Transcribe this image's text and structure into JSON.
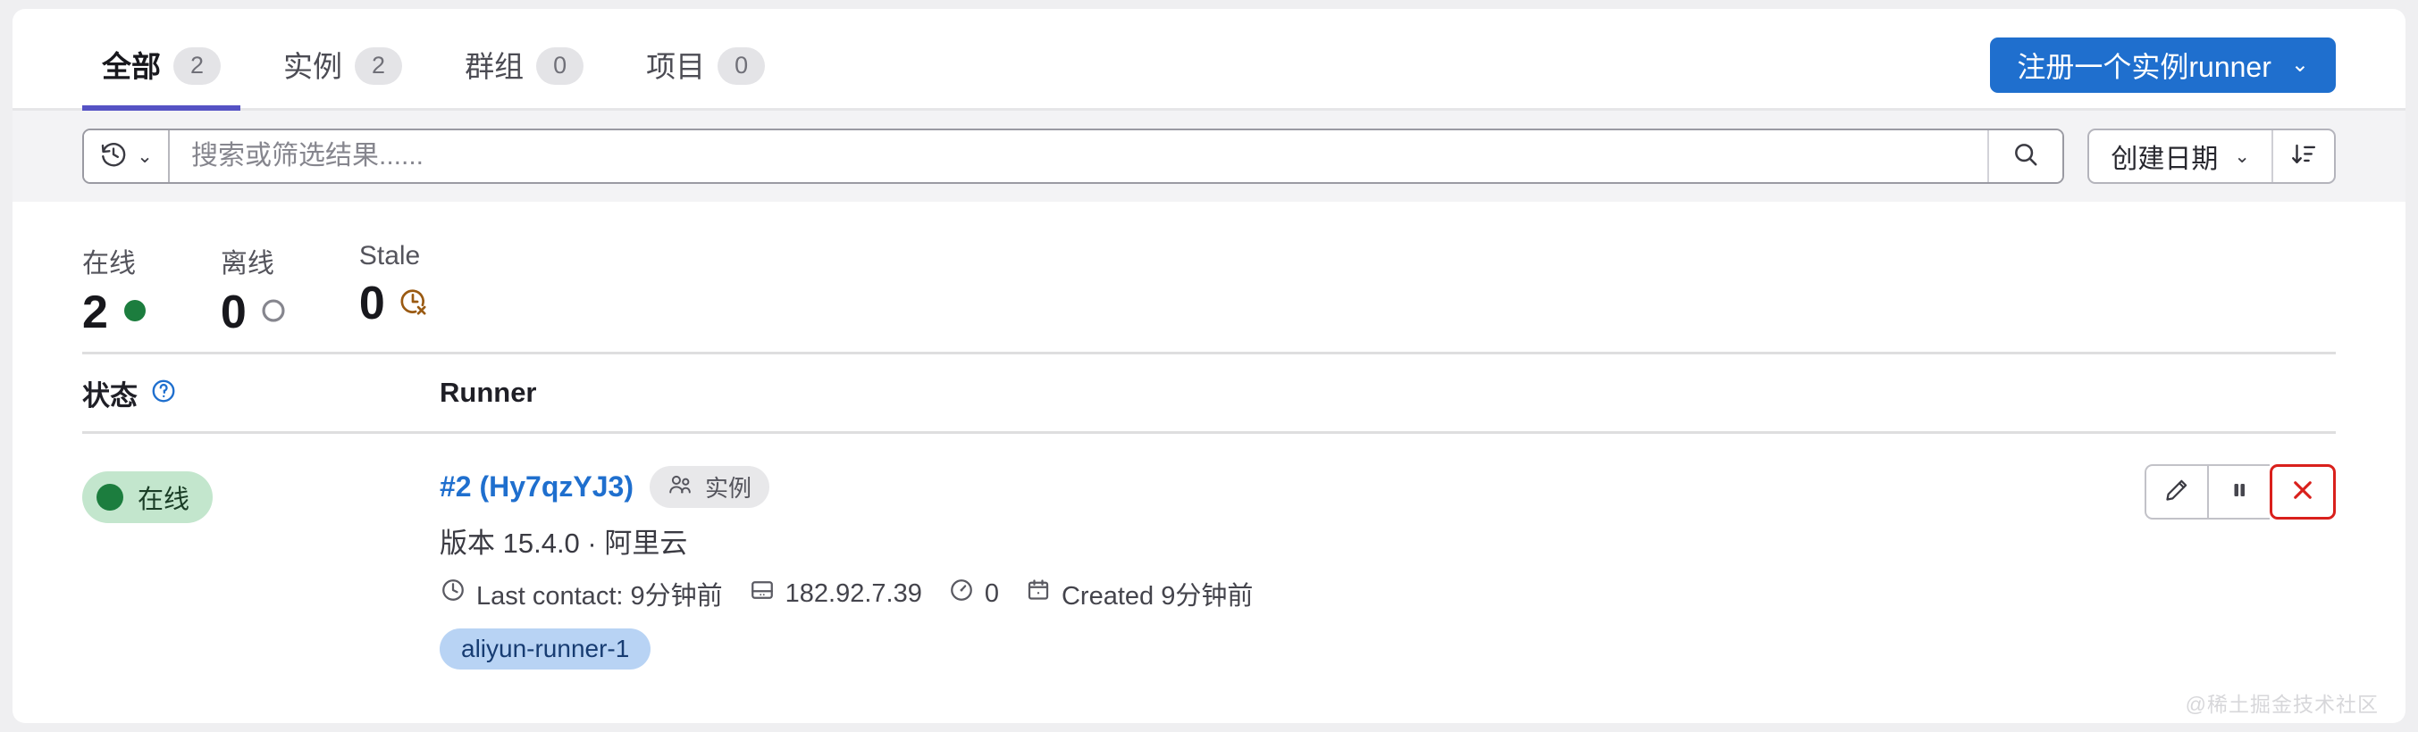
{
  "tabs": [
    {
      "label": "全部",
      "count": "2",
      "active": true
    },
    {
      "label": "实例",
      "count": "2",
      "active": false
    },
    {
      "label": "群组",
      "count": "0",
      "active": false
    },
    {
      "label": "项目",
      "count": "0",
      "active": false
    }
  ],
  "register_button": {
    "label": "注册一个实例runner",
    "chevron": "⌄",
    "color": "#1f6fce"
  },
  "filter": {
    "history_icon": "history-icon",
    "history_chevron": "⌄",
    "search_placeholder": "搜索或筛选结果......",
    "search_value": "",
    "search_icon": "search-icon",
    "sort_label": "创建日期",
    "sort_chevron": "⌄",
    "sort_direction_icon": "sort-descending-icon"
  },
  "stats": [
    {
      "label": "在线",
      "value": "2",
      "icon": "circle-filled-icon",
      "color": "#1c7d3e"
    },
    {
      "label": "离线",
      "value": "0",
      "icon": "circle-outline-icon",
      "color": "#86868e"
    },
    {
      "label": "Stale",
      "value": "0",
      "icon": "clock-x-icon",
      "color": "#9a5a12"
    }
  ],
  "table": {
    "header_status": "状态",
    "header_status_help_icon": "question-circle-icon",
    "header_runner": "Runner"
  },
  "runners": [
    {
      "status_badge": {
        "label": "在线",
        "dot_color": "#1c7d3e",
        "bg": "#c3e6cd"
      },
      "name": "#2 (Hy7qzYJ3)",
      "type_badge": {
        "label": "实例",
        "icon": "users-icon"
      },
      "version_line": "版本 15.4.0 · 阿里云",
      "meta": [
        {
          "icon": "clock-icon",
          "text": "Last contact: 9分钟前"
        },
        {
          "icon": "server-icon",
          "text": "182.92.7.39"
        },
        {
          "icon": "gauge-icon",
          "text": "0"
        },
        {
          "icon": "calendar-icon",
          "text": "Created 9分钟前"
        }
      ],
      "tags": [
        "aliyun-runner-1"
      ],
      "actions": [
        {
          "name": "edit-runner-button",
          "icon": "pencil-icon"
        },
        {
          "name": "pause-runner-button",
          "icon": "pause-icon"
        },
        {
          "name": "delete-runner-button",
          "icon": "close-x-icon"
        }
      ]
    }
  ],
  "watermark": "@稀土掘金技术社区"
}
